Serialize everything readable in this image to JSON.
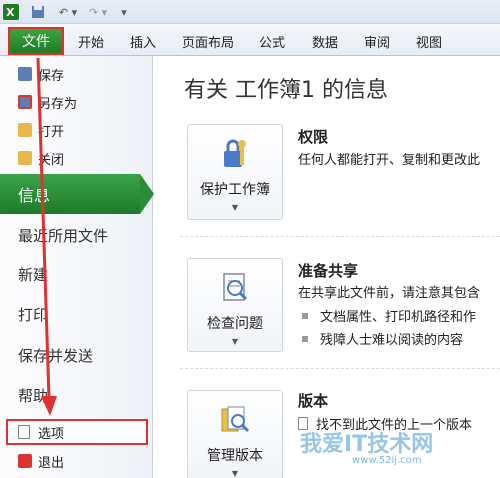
{
  "quick_access": {
    "app_icon": "excel-icon",
    "items": [
      "save-icon",
      "undo-icon",
      "redo-icon",
      "customize-icon"
    ]
  },
  "tabs": {
    "file": "文件",
    "items": [
      "开始",
      "插入",
      "页面布局",
      "公式",
      "数据",
      "审阅",
      "视图"
    ]
  },
  "nav": {
    "small_items": [
      {
        "label": "保存",
        "icon": "save-icon"
      },
      {
        "label": "另存为",
        "icon": "save-as-icon"
      },
      {
        "label": "打开",
        "icon": "open-folder-icon"
      },
      {
        "label": "关闭",
        "icon": "close-folder-icon"
      }
    ],
    "info": "信息",
    "big_items": [
      "最近所用文件",
      "新建",
      "打印",
      "保存并发送",
      "帮助"
    ],
    "options": "选项",
    "exit": "退出"
  },
  "main": {
    "title": "有关 工作簿1 的信息",
    "sections": [
      {
        "button": "保护工作簿",
        "icon": "lock-key-icon",
        "heading": "权限",
        "desc": "任何人都能打开、复制和更改此",
        "bullets": []
      },
      {
        "button": "检查问题",
        "icon": "inspect-document-icon",
        "heading": "准备共享",
        "desc": "在共享此文件前，请注意其包含",
        "bullets": [
          "文档属性、打印机路径和作",
          "残障人士难以阅读的内容"
        ]
      },
      {
        "button": "管理版本",
        "icon": "versions-icon",
        "heading": "版本",
        "desc": "找不到此文件的上一个版本",
        "bullets": []
      }
    ]
  },
  "watermark": {
    "main": "我爱IT技术网",
    "sub": "www.52ij.com"
  },
  "colors": {
    "accent_green": "#2b8d38",
    "annotation_red": "#e0302f"
  }
}
